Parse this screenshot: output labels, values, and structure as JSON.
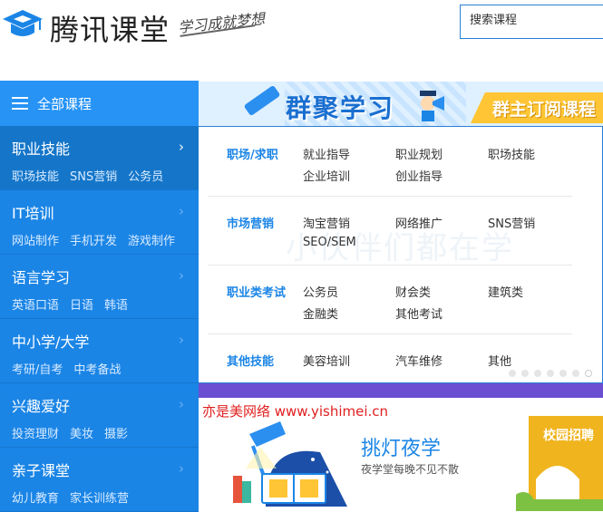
{
  "header": {
    "brand": "腾讯课堂",
    "slogan": "学习成就梦想",
    "search_placeholder": "搜索课程"
  },
  "sidebar": {
    "title": "全部课程",
    "categories": [
      {
        "title": "职业技能",
        "subs": [
          "职场技能",
          "SNS营销",
          "公务员"
        ]
      },
      {
        "title": "IT培训",
        "subs": [
          "网站制作",
          "手机开发",
          "游戏制作"
        ]
      },
      {
        "title": "语言学习",
        "subs": [
          "英语口语",
          "日语",
          "韩语"
        ]
      },
      {
        "title": "中小学/大学",
        "subs": [
          "考研/自考",
          "中考备战"
        ]
      },
      {
        "title": "兴趣爱好",
        "subs": [
          "投资理财",
          "美妆",
          "摄影"
        ]
      },
      {
        "title": "亲子课堂",
        "subs": [
          "幼儿教育",
          "家长训练营"
        ]
      }
    ]
  },
  "banner": {
    "title": "群聚学习",
    "tag": "群主订阅课程"
  },
  "panel": {
    "watermark": "小伙伴们都在学",
    "groups": [
      {
        "name": "职场/求职",
        "links": [
          "就业指导",
          "职业规划",
          "职场技能",
          "企业培训",
          "创业指导"
        ]
      },
      {
        "name": "市场营销",
        "links": [
          "淘宝营销",
          "网络推广",
          "SNS营销",
          "SEO/SEM"
        ]
      },
      {
        "name": "职业类考试",
        "links": [
          "公务员",
          "财会类",
          "建筑类",
          "金融类",
          "其他考试"
        ]
      },
      {
        "name": "其他技能",
        "links": [
          "美容培训",
          "汽车维修",
          "其他"
        ]
      }
    ]
  },
  "card": {
    "watermark": "亦是美网络 www.yishimei.cn",
    "title": "挑灯夜学",
    "subtitle": "夜学堂每晚不见不散",
    "campus_label": "校园招聘"
  },
  "colors": {
    "primary": "#1b85e6",
    "sidebar_head": "#2693f5",
    "accent_yellow": "#ffc534",
    "strip_purple": "#6a4fd2"
  }
}
